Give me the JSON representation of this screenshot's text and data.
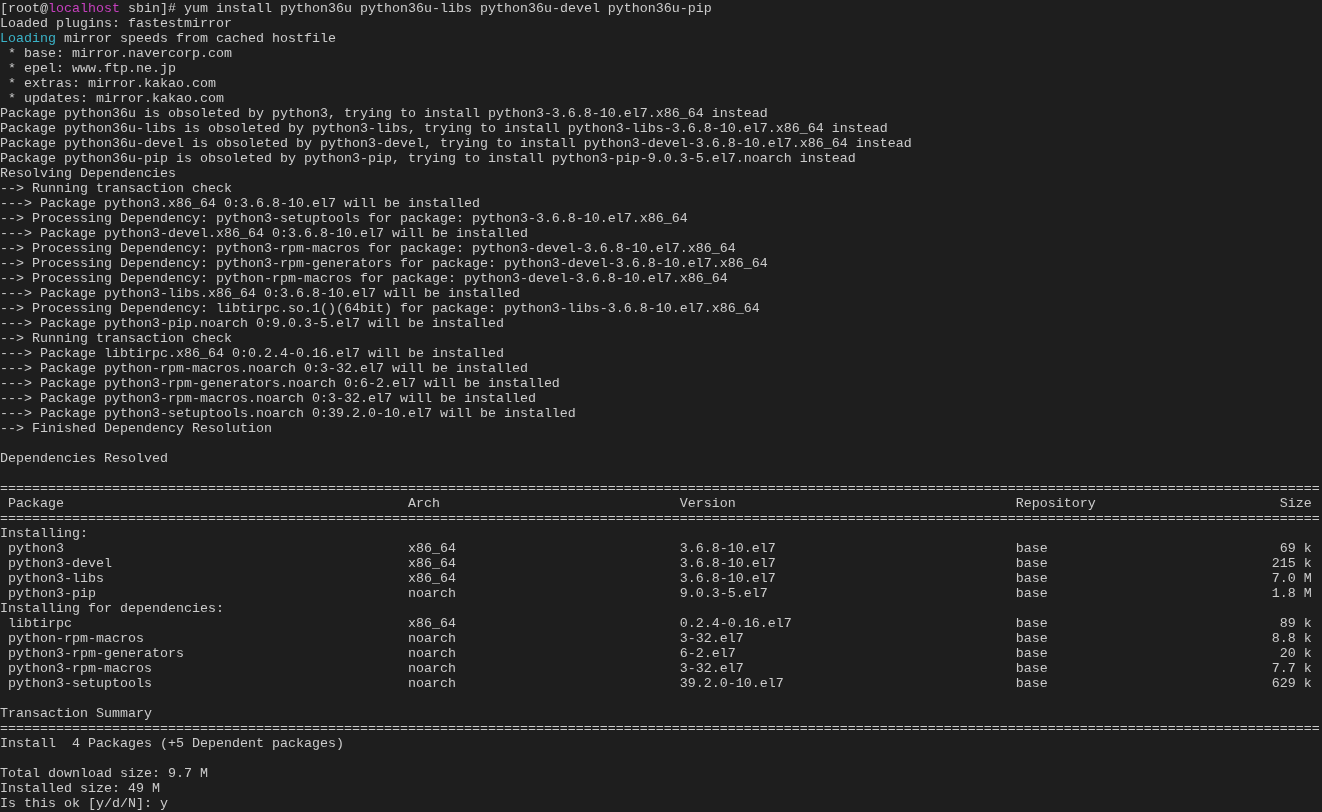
{
  "terminal": {
    "lines": [
      {
        "kind": "segments",
        "segments": [
          {
            "text": "[root@"
          },
          {
            "text": "localhost",
            "color": "#c640be"
          },
          {
            "text": " sbin]# yum install python36u python36u-libs python36u-devel python36u-pip"
          }
        ]
      },
      {
        "kind": "text",
        "text": "Loaded plugins: fastestmirror"
      },
      {
        "kind": "segments",
        "segments": [
          {
            "text": "Loading",
            "color": "#3bb3c8"
          },
          {
            "text": " mirror speeds from cached hostfile"
          }
        ]
      },
      {
        "kind": "text",
        "text": " * base: mirror.navercorp.com"
      },
      {
        "kind": "text",
        "text": " * epel: www.ftp.ne.jp"
      },
      {
        "kind": "text",
        "text": " * extras: mirror.kakao.com"
      },
      {
        "kind": "text",
        "text": " * updates: mirror.kakao.com"
      },
      {
        "kind": "text",
        "text": "Package python36u is obsoleted by python3, trying to install python3-3.6.8-10.el7.x86_64 instead"
      },
      {
        "kind": "text",
        "text": "Package python36u-libs is obsoleted by python3-libs, trying to install python3-libs-3.6.8-10.el7.x86_64 instead"
      },
      {
        "kind": "text",
        "text": "Package python36u-devel is obsoleted by python3-devel, trying to install python3-devel-3.6.8-10.el7.x86_64 instead"
      },
      {
        "kind": "text",
        "text": "Package python36u-pip is obsoleted by python3-pip, trying to install python3-pip-9.0.3-5.el7.noarch instead"
      },
      {
        "kind": "text",
        "text": "Resolving Dependencies"
      },
      {
        "kind": "text",
        "text": "--> Running transaction check"
      },
      {
        "kind": "text",
        "text": "---> Package python3.x86_64 0:3.6.8-10.el7 will be installed"
      },
      {
        "kind": "text",
        "text": "--> Processing Dependency: python3-setuptools for package: python3-3.6.8-10.el7.x86_64"
      },
      {
        "kind": "text",
        "text": "---> Package python3-devel.x86_64 0:3.6.8-10.el7 will be installed"
      },
      {
        "kind": "text",
        "text": "--> Processing Dependency: python3-rpm-macros for package: python3-devel-3.6.8-10.el7.x86_64"
      },
      {
        "kind": "text",
        "text": "--> Processing Dependency: python3-rpm-generators for package: python3-devel-3.6.8-10.el7.x86_64"
      },
      {
        "kind": "text",
        "text": "--> Processing Dependency: python-rpm-macros for package: python3-devel-3.6.8-10.el7.x86_64"
      },
      {
        "kind": "text",
        "text": "---> Package python3-libs.x86_64 0:3.6.8-10.el7 will be installed"
      },
      {
        "kind": "text",
        "text": "--> Processing Dependency: libtirpc.so.1()(64bit) for package: python3-libs-3.6.8-10.el7.x86_64"
      },
      {
        "kind": "text",
        "text": "---> Package python3-pip.noarch 0:9.0.3-5.el7 will be installed"
      },
      {
        "kind": "text",
        "text": "--> Running transaction check"
      },
      {
        "kind": "text",
        "text": "---> Package libtirpc.x86_64 0:0.2.4-0.16.el7 will be installed"
      },
      {
        "kind": "text",
        "text": "---> Package python-rpm-macros.noarch 0:3-32.el7 will be installed"
      },
      {
        "kind": "text",
        "text": "---> Package python3-rpm-generators.noarch 0:6-2.el7 will be installed"
      },
      {
        "kind": "text",
        "text": "---> Package python3-rpm-macros.noarch 0:3-32.el7 will be installed"
      },
      {
        "kind": "text",
        "text": "---> Package python3-setuptools.noarch 0:39.2.0-10.el7 will be installed"
      },
      {
        "kind": "text",
        "text": "--> Finished Dependency Resolution"
      },
      {
        "kind": "blank"
      },
      {
        "kind": "text",
        "text": "Dependencies Resolved"
      },
      {
        "kind": "blank"
      }
    ],
    "table": {
      "rule": "=====================================================================================================================================================================",
      "columns": [
        "Package",
        "Arch",
        "Version",
        "Repository",
        "Size"
      ],
      "sections": [
        {
          "heading": "Installing:",
          "rows": [
            [
              "python3",
              "x86_64",
              "3.6.8-10.el7",
              "base",
              "69 k"
            ],
            [
              "python3-devel",
              "x86_64",
              "3.6.8-10.el7",
              "base",
              "215 k"
            ],
            [
              "python3-libs",
              "x86_64",
              "3.6.8-10.el7",
              "base",
              "7.0 M"
            ],
            [
              "python3-pip",
              "noarch",
              "9.0.3-5.el7",
              "base",
              "1.8 M"
            ]
          ]
        },
        {
          "heading": "Installing for dependencies:",
          "rows": [
            [
              "libtirpc",
              "x86_64",
              "0.2.4-0.16.el7",
              "base",
              "89 k"
            ],
            [
              "python-rpm-macros",
              "noarch",
              "3-32.el7",
              "base",
              "8.8 k"
            ],
            [
              "python3-rpm-generators",
              "noarch",
              "6-2.el7",
              "base",
              "20 k"
            ],
            [
              "python3-rpm-macros",
              "noarch",
              "3-32.el7",
              "base",
              "7.7 k"
            ],
            [
              "python3-setuptools",
              "noarch",
              "39.2.0-10.el7",
              "base",
              "629 k"
            ]
          ]
        }
      ]
    },
    "summary": {
      "title": "Transaction Summary",
      "rule": "=====================================================================================================================================================================",
      "lines": [
        {
          "kind": "text",
          "text": "Install  4 Packages (+5 Dependent packages)"
        },
        {
          "kind": "blank"
        },
        {
          "kind": "text",
          "text": "Total download size: 9.7 M"
        },
        {
          "kind": "text",
          "text": "Installed size: 49 M"
        },
        {
          "kind": "text",
          "text": "Is this ok [y/d/N]: y"
        }
      ]
    }
  }
}
